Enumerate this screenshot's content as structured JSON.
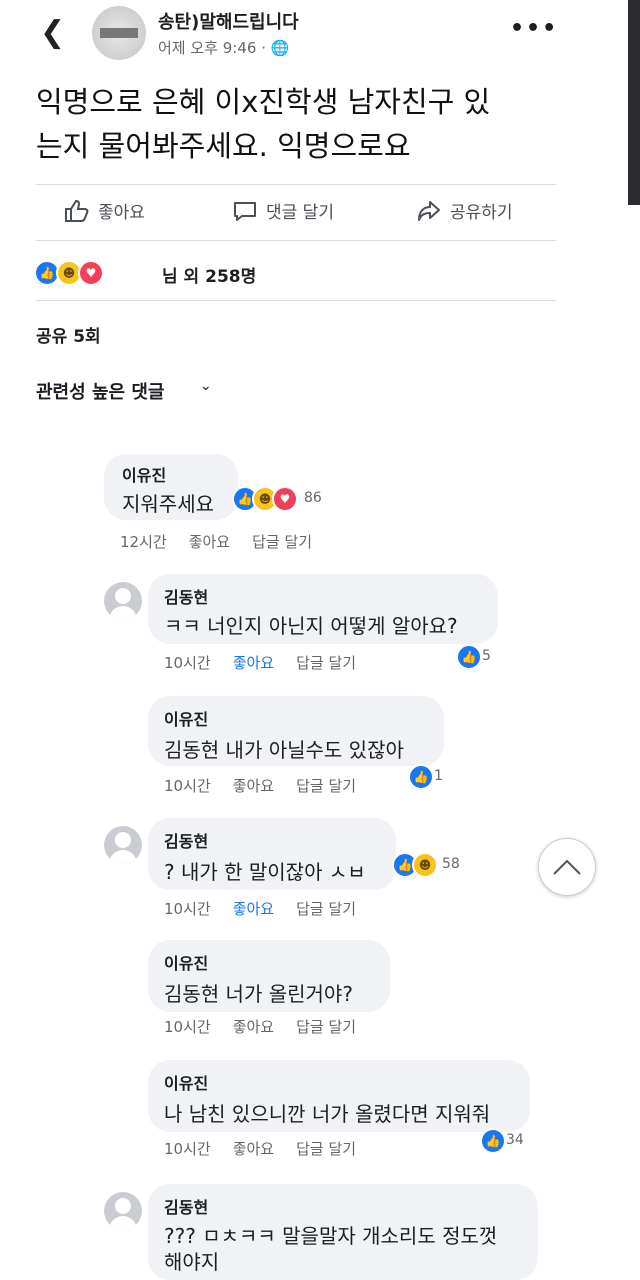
{
  "header": {
    "page_name": "송탄)말해드립니다",
    "post_time": "어제 오후 9:46 · ",
    "globe_icon": "globe-icon"
  },
  "post": {
    "text_line1": "익명으로 은혜 이x진학생 남자친구 있",
    "text_line2": "는지 물어봐주세요. 익명으로요"
  },
  "actions": {
    "like": "좋아요",
    "comment": "댓글 달기",
    "share": "공유하기"
  },
  "reactions": {
    "summary": "님 외 258명",
    "shares": "공유 5회"
  },
  "sort": {
    "label": "관련성 높은 댓글"
  },
  "comments": [
    {
      "name": "이유진",
      "text": "지워주세요",
      "count": "86",
      "time": "12시간",
      "like": "좋아요",
      "reply": "답글 달기"
    },
    {
      "name": "김동현",
      "text": "ㅋㅋ 너인지 아닌지 어떻게 알아요?",
      "count": "5",
      "time": "10시간",
      "like": "좋아요",
      "reply": "답글 달기"
    },
    {
      "name": "이유진",
      "text": "김동현  내가 아닐수도 있잖아",
      "count": "1",
      "time": "10시간",
      "like": "좋아요",
      "reply": "답글 달기"
    },
    {
      "name": "김동현",
      "text": "? 내가 한 말이잖아 ㅅㅂ",
      "count": "58",
      "time": "10시간",
      "like": "좋아요",
      "reply": "답글 달기"
    },
    {
      "name": "이유진",
      "text": "김동현  너가 올린거야?",
      "time": "10시간",
      "like": "좋아요",
      "reply": "답글 달기"
    },
    {
      "name": "이유진",
      "text": "나 남친 있으니깐 너가 올렸다면 지워줘",
      "count": "34",
      "time": "10시간",
      "like": "좋아요",
      "reply": "답글 달기"
    },
    {
      "name": "김동현",
      "text_line1": "??? ㅁㅊㅋㅋ 말을말자 개소리도 정도껏",
      "text_line2": "해야지"
    }
  ],
  "colors": {
    "accent": "#1877f2",
    "bubble": "#f0f2f5",
    "love": "#f33e58",
    "haha": "#f7c41f"
  }
}
